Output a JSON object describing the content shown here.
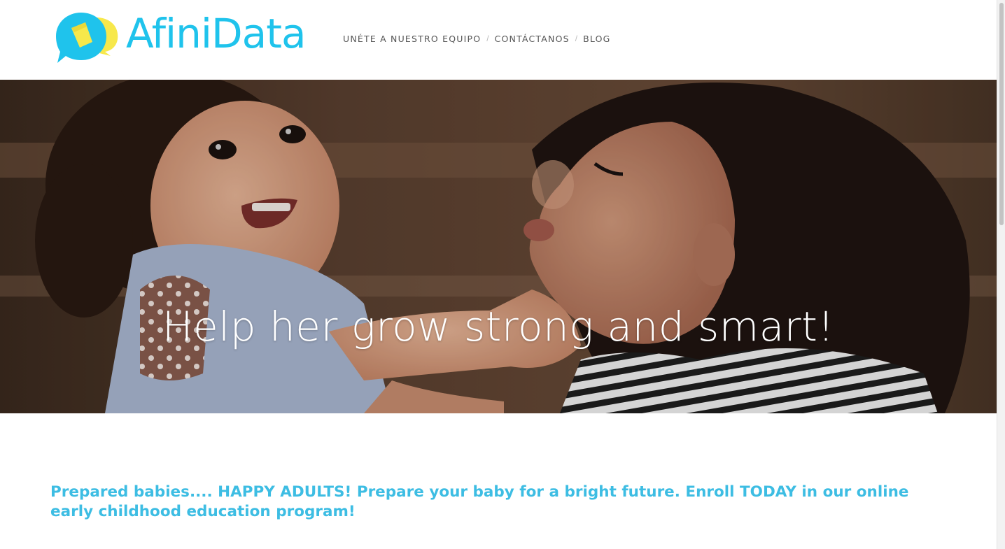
{
  "brand": {
    "name": "AfiniData",
    "color": "#1fc3ec",
    "accent": "#f7e84b"
  },
  "nav": {
    "items": [
      {
        "label": "UNÉTE A NUESTRO EQUIPO"
      },
      {
        "label": "CONTÁCTANOS"
      },
      {
        "label": "BLOG"
      }
    ],
    "separator": "/"
  },
  "hero": {
    "headline": "Help her grow strong and smart!"
  },
  "tagline": {
    "text": "Prepared babies.... HAPPY ADULTS! Prepare your baby for a bright future. Enroll TODAY in our online early childhood education program!",
    "color": "#3dbde3"
  },
  "icons": {
    "logo": "chat-bubbles-icon"
  }
}
